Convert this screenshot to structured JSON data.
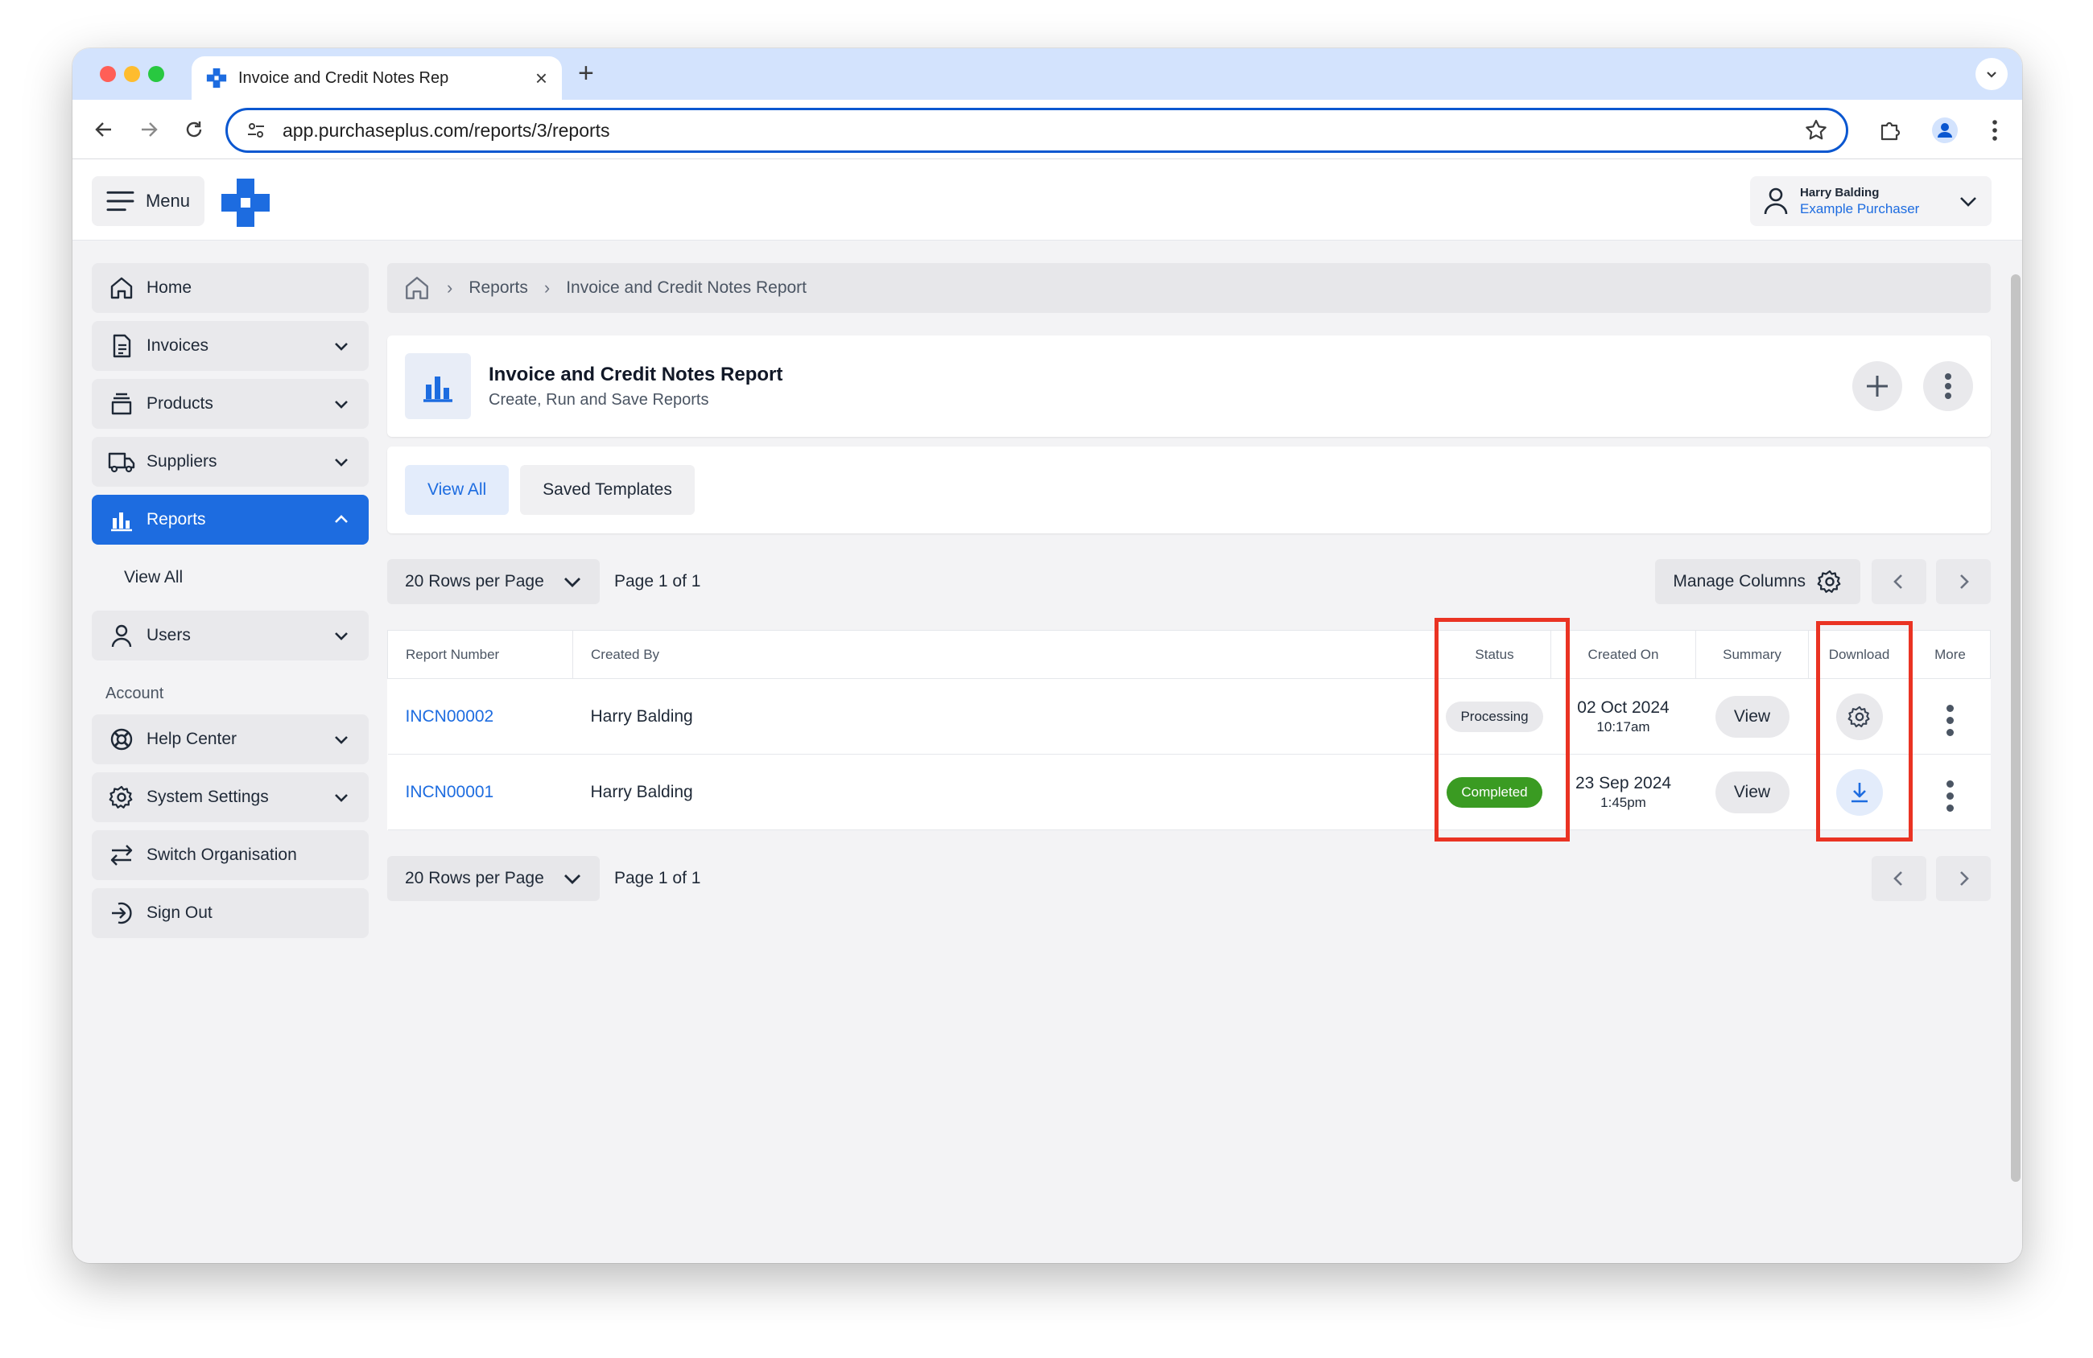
{
  "browser": {
    "tab_title": "Invoice and Credit Notes Rep",
    "url": "app.purchaseplus.com/reports/3/reports"
  },
  "header": {
    "menu_label": "Menu",
    "user_name": "Harry Balding",
    "user_role": "Example Purchaser"
  },
  "sidebar": {
    "items": [
      {
        "label": "Home",
        "icon": "home-icon"
      },
      {
        "label": "Invoices",
        "icon": "document-icon"
      },
      {
        "label": "Products",
        "icon": "box-icon"
      },
      {
        "label": "Suppliers",
        "icon": "truck-icon"
      },
      {
        "label": "Reports",
        "icon": "bar-chart-icon"
      },
      {
        "label": "Users",
        "icon": "user-icon"
      }
    ],
    "sub_items": [
      {
        "label": "View All"
      }
    ],
    "account_heading": "Account",
    "account_items": [
      {
        "label": "Help Center",
        "icon": "lifebuoy-icon"
      },
      {
        "label": "System Settings",
        "icon": "gear-icon"
      },
      {
        "label": "Switch Organisation",
        "icon": "switch-arrows-icon"
      },
      {
        "label": "Sign Out",
        "icon": "sign-out-icon"
      }
    ]
  },
  "breadcrumb": {
    "items": [
      "Reports",
      "Invoice and Credit Notes Report"
    ]
  },
  "page": {
    "title": "Invoice and Credit Notes Report",
    "subtitle": "Create, Run and Save Reports"
  },
  "tabs": [
    "View All",
    "Saved Templates"
  ],
  "pager": {
    "rows_per_page": "20 Rows per Page",
    "page_info": "Page 1 of 1",
    "manage_columns": "Manage Columns"
  },
  "table": {
    "headers": [
      "Report Number",
      "Created By",
      "Status",
      "Created On",
      "Summary",
      "Download",
      "More"
    ],
    "rows": [
      {
        "number": "INCN00002",
        "created_by": "Harry Balding",
        "status": "Processing",
        "date": "02 Oct 2024",
        "time": "10:17am",
        "summary": "View",
        "download": "gear-icon"
      },
      {
        "number": "INCN00001",
        "created_by": "Harry Balding",
        "status": "Completed",
        "date": "23 Sep 2024",
        "time": "1:45pm",
        "summary": "View",
        "download": "download-icon"
      }
    ]
  },
  "colors": {
    "accent": "#1d6ce0",
    "completed": "#3a9b22",
    "highlight": "#ea3323"
  }
}
